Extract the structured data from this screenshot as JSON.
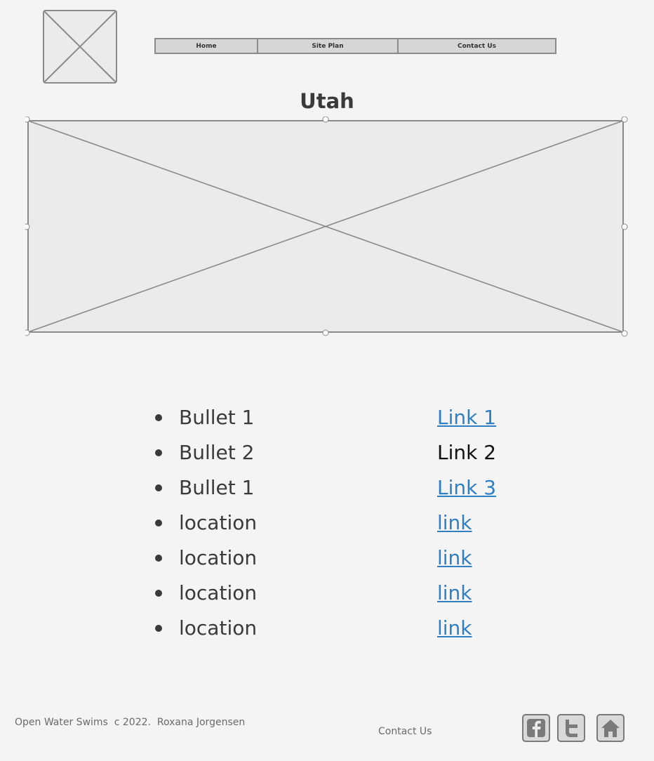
{
  "nav": {
    "home": "Home",
    "site_plan": "Site Plan",
    "contact_us": "Contact Us"
  },
  "page": {
    "title": "Utah"
  },
  "bullets": [
    "Bullet 1",
    "Bullet 2",
    "Bullet 1",
    "location",
    "location",
    "location",
    "location"
  ],
  "links": [
    "Link 1",
    "Link 2",
    "Link 3",
    "link",
    "link",
    "link",
    "link"
  ],
  "footer": {
    "copyright": "Open Water Swims  c 2022.  Roxana Jorgensen",
    "contact": "Contact Us"
  },
  "icons": {
    "logo": "image-placeholder-icon",
    "hero": "image-placeholder-icon",
    "facebook": "facebook-icon",
    "twitter": "twitter-icon",
    "home": "home-icon"
  },
  "colors": {
    "background": "#f4f4f4",
    "link": "#2e7fc4",
    "nav_bg": "#d6d6d6",
    "placeholder_fill": "#ebebeb",
    "placeholder_stroke": "#8a8a8a"
  }
}
